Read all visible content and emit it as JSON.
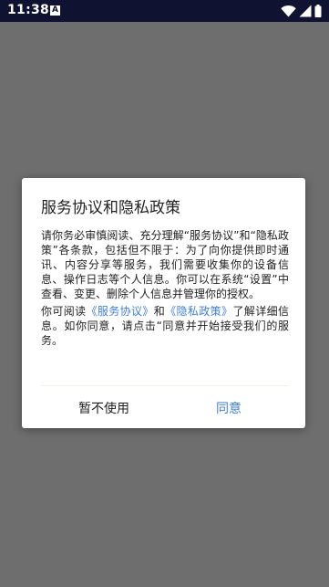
{
  "status_bar": {
    "time": "11:38",
    "notification_icon": "A"
  },
  "dialog": {
    "title": "服务协议和隐私政策",
    "para1": "请你务必审慎阅读、充分理解“服务协议”和“隐私政策”各条款，包括但不限于：为了向你提供即时通讯、内容分享等服务，我们需要收集你的设备信息、操作日志等个人信息。你可以在系统“设置”中查看、变更、删除个人信息并管理你的授权。",
    "para2_prefix": "你可阅读",
    "service_link": "《服务协议》",
    "para2_and": "和",
    "privacy_link": "《隐私政策》",
    "para2_suffix": "了解详细信息。如你同意，请点击“同意并开始接受我们的服务。",
    "decline_label": "暂不使用",
    "agree_label": "同意"
  },
  "colors": {
    "link": "#3f7fd4",
    "status_bar_bg": "#0f1230",
    "scrim": "#6e6e6e"
  },
  "icons": [
    "a-notification-icon",
    "wifi-icon",
    "cellular-signal-icon",
    "battery-icon"
  ]
}
